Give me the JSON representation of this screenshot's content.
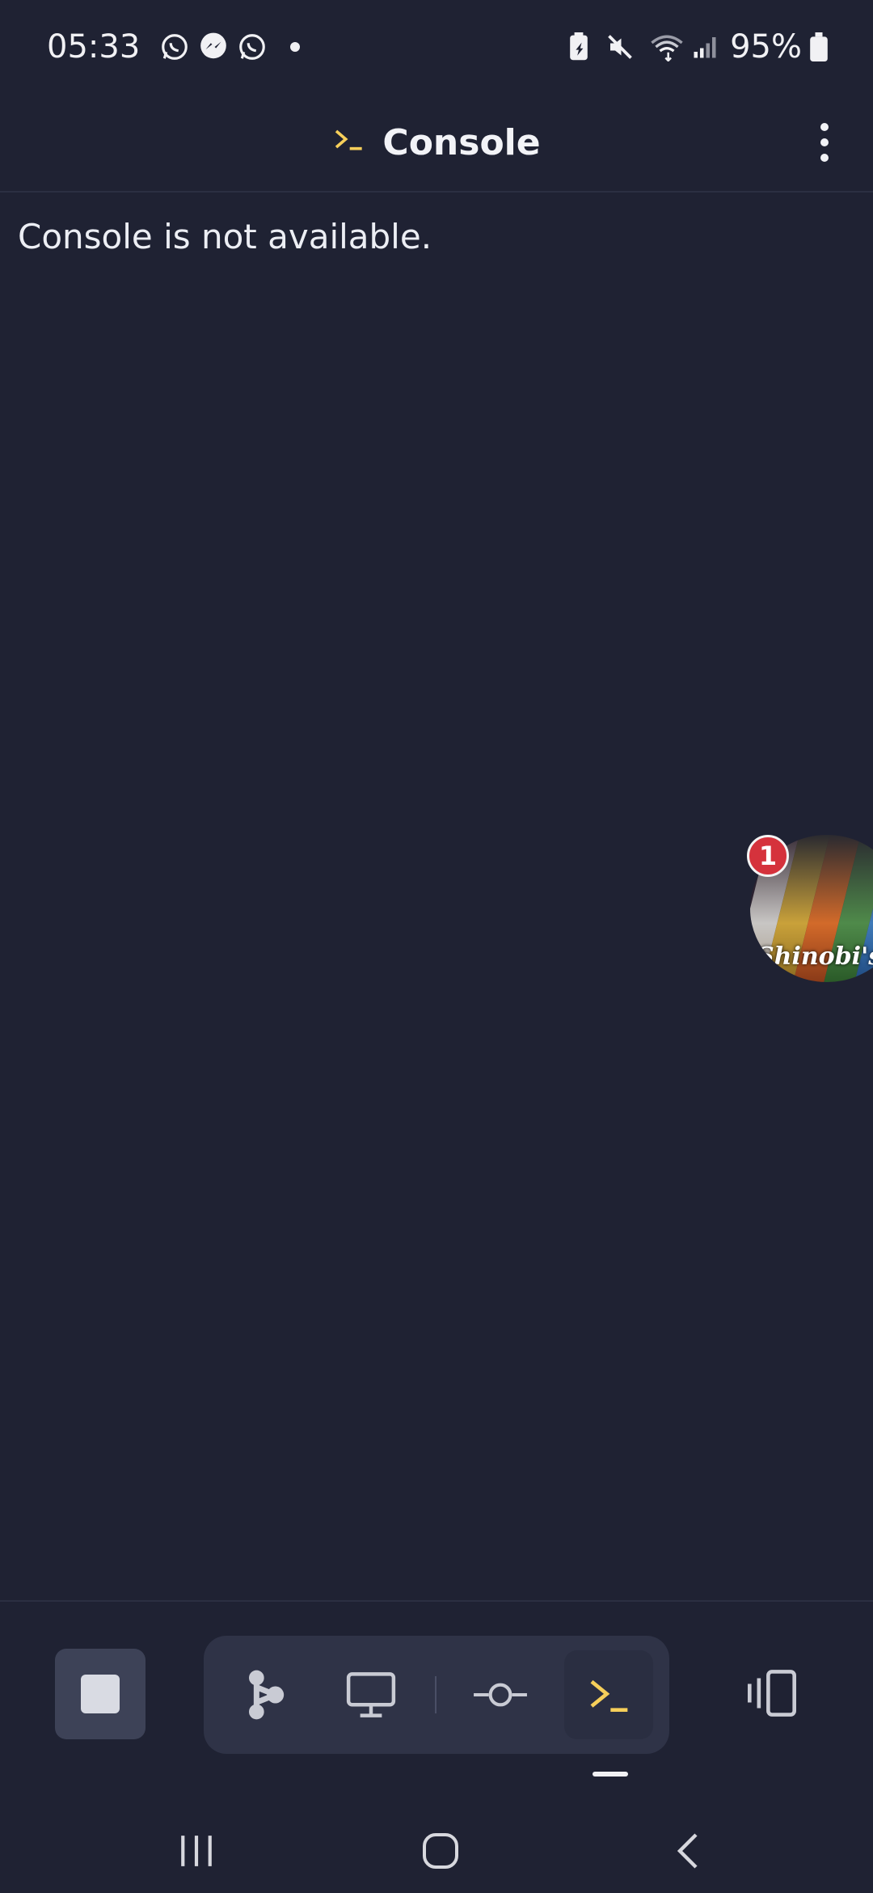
{
  "status_bar": {
    "time": "05:33",
    "battery_percent": "95%",
    "notification_icons": [
      "whatsapp-icon",
      "messenger-icon",
      "whatsapp-icon"
    ],
    "system_icons": [
      "battery-saver-icon",
      "mute-icon",
      "wifi-icon",
      "signal-icon",
      "battery-icon"
    ]
  },
  "header": {
    "title": "Console",
    "title_icon": "terminal-prompt-icon",
    "menu_icon": "more-vertical-icon"
  },
  "console": {
    "message": "Console is not available."
  },
  "chat_bubble": {
    "badge_count": "1",
    "image_text": "Shinobi's Path"
  },
  "toolbar": {
    "stop_icon": "stop-icon",
    "tools": [
      "hierarchy-icon",
      "monitor-icon",
      "commit-icon",
      "terminal-prompt-icon"
    ],
    "active_tool": "terminal-prompt-icon",
    "devices_icon": "devices-icon"
  },
  "colors": {
    "background": "#1f2233",
    "accent": "#f6cf5a",
    "badge": "#d5323c"
  }
}
